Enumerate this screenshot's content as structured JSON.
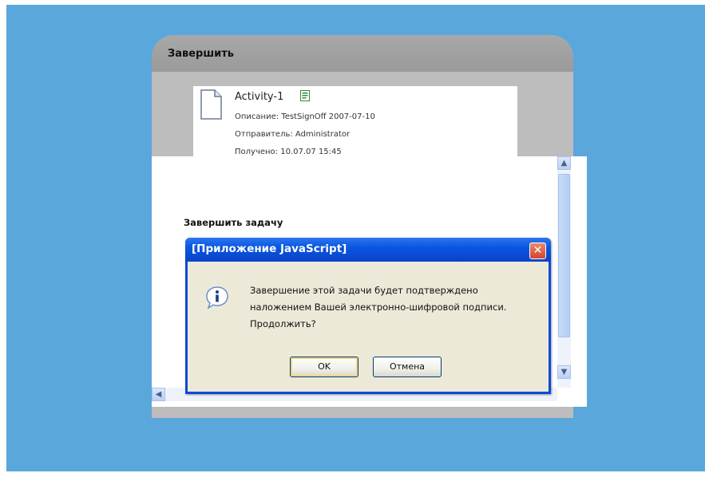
{
  "panel": {
    "title": "Завершить"
  },
  "activity": {
    "name": "Activity-1",
    "description_label": "Описание:",
    "description_value": "TestSignOff 2007-07-10",
    "sender_label": "Отправитель:",
    "sender_value": "Administrator",
    "received_label": "Получено:",
    "received_value": "10.07.07 15:45"
  },
  "content": {
    "section_title": "Завершить задачу"
  },
  "dialog": {
    "title": "[Приложение JavaScript]",
    "message_lines": [
      "Завершение этой задачи будет подтверждено",
      "наложением Вашей электронно-шифровой подписи.",
      "Продолжить?"
    ],
    "ok_label": "OK",
    "cancel_label": "Отмена"
  },
  "colors": {
    "desktop": "#5aa7dc",
    "dialog_title": "#0a56e0",
    "dialog_body": "#ece9d8"
  },
  "icons": {
    "close": "close-icon",
    "info": "info-icon",
    "document": "document-icon"
  }
}
